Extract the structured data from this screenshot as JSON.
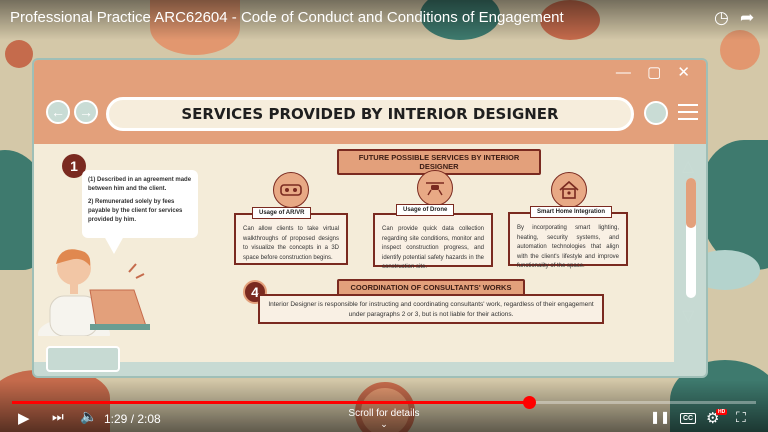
{
  "video": {
    "title": "Professional Practice ARC62604 - Code of Conduct and Conditions of Engagement"
  },
  "top_icons": [
    "clock-icon",
    "share-icon"
  ],
  "slide": {
    "title": "SERVICES PROVIDED BY INTERIOR DESIGNER",
    "window_controls": "— ▢ ✕",
    "badge_1": "1",
    "badge_4": "4",
    "bubble": {
      "line1": "(1) Described in an agreement made between him and the client.",
      "line2": "2) Remunerated solely by fees payable by the client for services provided by him."
    },
    "future_section": "FUTURE POSSIBLE SERVICES BY INTERIOR DESIGNER",
    "services": [
      {
        "icon": "vr-headset-icon",
        "label": "Usage of AR/VR",
        "text": "Can allow clients to take virtual walkthroughs of proposed designs to visualize the concepts in a 3D space before construction begins."
      },
      {
        "icon": "drone-icon",
        "label": "Usage of Drone",
        "text": "Can provide quick data collection regarding site conditions, monitor and inspect construction progress, and identify potential safety hazards in the construction site."
      },
      {
        "icon": "smart-home-icon",
        "label": "Smart Home Integration",
        "text": "By incorporating smart lighting, heating, security systems, and automation technologies that align with the client's lifestyle and improve functionality of the space."
      }
    ],
    "coordination_section": "COORDINATION OF CONSULTANTS' WORKS",
    "coordination_text": "Interior Designer is responsible for instructing and coordinating consultants' work, regardless of their engagement under paragraphs 2 or 3, but is not liable for their actions."
  },
  "player": {
    "time": "1:29 / 2:08",
    "progress": 0.695,
    "scroll_hint": "Scroll for details",
    "cc": "CC",
    "hd": "HD",
    "accent": "#ff0000"
  }
}
